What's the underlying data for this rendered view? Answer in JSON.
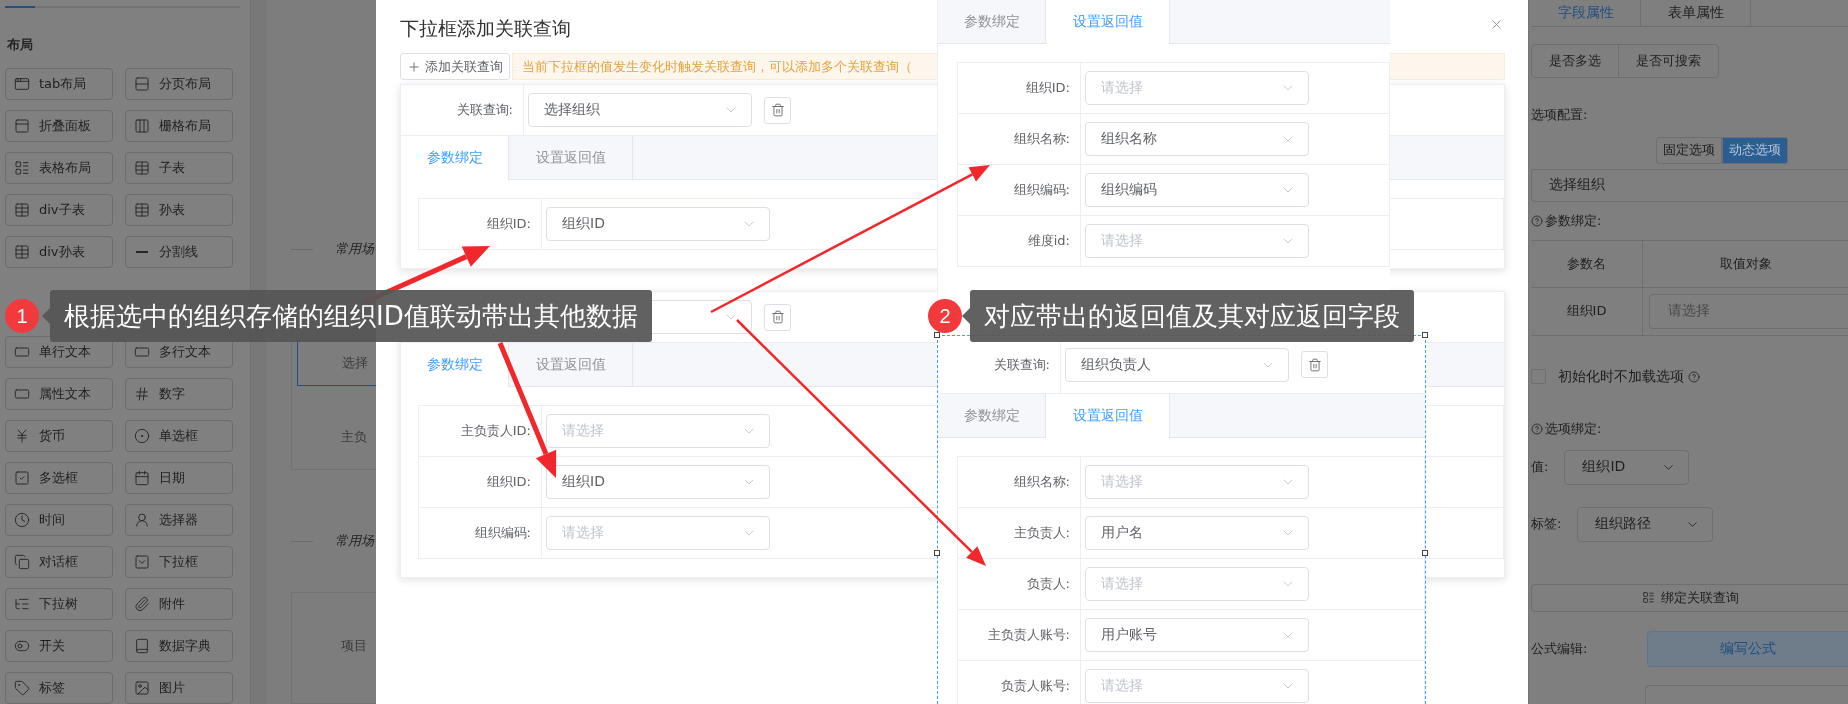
{
  "sidebar": {
    "sections": [
      {
        "title": "布局",
        "items": [
          {
            "label": "tab布局"
          },
          {
            "label": "分页布局"
          },
          {
            "label": "折叠面板"
          },
          {
            "label": "栅格布局"
          },
          {
            "label": "表格布局"
          },
          {
            "label": "子表"
          },
          {
            "label": "div子表"
          },
          {
            "label": "孙表"
          },
          {
            "label": "div孙表"
          },
          {
            "label": "分割线"
          }
        ]
      },
      {
        "items": [
          {
            "label": "单行文本"
          },
          {
            "label": "多行文本"
          },
          {
            "label": "属性文本"
          },
          {
            "label": "数字"
          },
          {
            "label": "货币"
          },
          {
            "label": "单选框"
          },
          {
            "label": "多选框"
          },
          {
            "label": "日期"
          },
          {
            "label": "时间"
          },
          {
            "label": "选择器"
          },
          {
            "label": "对话框"
          },
          {
            "label": "下拉框"
          },
          {
            "label": "下拉树"
          },
          {
            "label": "附件"
          },
          {
            "label": "开关"
          },
          {
            "label": "数据字典"
          },
          {
            "label": "标签"
          },
          {
            "label": "图片"
          }
        ]
      }
    ]
  },
  "canvas": {
    "headings": [
      "常用场",
      "常用场"
    ],
    "field_value": "选择",
    "texts": [
      "主负",
      "项目"
    ]
  },
  "dialog": {
    "title": "下拉框添加关联查询",
    "add_button": "添加关联查询",
    "notice": "当前下拉框的值发生变化时触发关联查询，可以添加多个关联查询（",
    "queries": [
      {
        "label": "关联查询:",
        "value": "选择组织",
        "tabs": [
          {
            "label": "参数绑定",
            "selected": true
          },
          {
            "label": "设置返回值",
            "selected": false
          }
        ],
        "fields": [
          {
            "label": "组织ID:",
            "value": "组织ID"
          }
        ]
      },
      {
        "tabs": [
          {
            "label": "参数绑定",
            "selected": true
          },
          {
            "label": "设置返回值",
            "selected": false
          }
        ],
        "fields": [
          {
            "label": "主负责人ID:",
            "placeholder": "请选择"
          },
          {
            "label": "组织ID:",
            "value": "组织ID"
          },
          {
            "label": "组织编码:",
            "placeholder": "请选择"
          }
        ]
      }
    ]
  },
  "overlays": [
    {
      "tabs": [
        {
          "label": "参数绑定",
          "selected": false
        },
        {
          "label": "设置返回值",
          "selected": true
        }
      ],
      "fields": [
        {
          "label": "组织ID:",
          "placeholder": "请选择"
        },
        {
          "label": "组织名称:",
          "value": "组织名称"
        },
        {
          "label": "组织编码:",
          "value": "组织编码"
        },
        {
          "label": "维度id:",
          "placeholder": "请选择"
        }
      ]
    },
    {
      "label": "关联查询:",
      "value": "组织负责人",
      "tabs": [
        {
          "label": "参数绑定",
          "selected": false
        },
        {
          "label": "设置返回值",
          "selected": true
        }
      ],
      "fields": [
        {
          "label": "组织名称:",
          "placeholder": "请选择"
        },
        {
          "label": "主负责人:",
          "value": "用户名"
        },
        {
          "label": "负责人:",
          "placeholder": "请选择"
        },
        {
          "label": "主负责人账号:",
          "value": "用户账号"
        },
        {
          "label": "负责人账号:",
          "placeholder": "请选择"
        }
      ]
    }
  ],
  "callouts": [
    {
      "number": "1",
      "text": "根据选中的组织存储的组织ID值联动带出其他数据"
    },
    {
      "number": "2",
      "text": "对应带出的返回值及其对应返回字段"
    }
  ],
  "right_panel": {
    "tabs": [
      {
        "label": "字段属性",
        "selected": true
      },
      {
        "label": "表单属性",
        "selected": false
      }
    ],
    "toggles": [
      "是否多选",
      "是否可搜索"
    ],
    "options_label": "选项配置:",
    "option_modes": [
      {
        "label": "固定选项",
        "selected": false
      },
      {
        "label": "动态选项",
        "selected": true
      }
    ],
    "source_value": "选择组织",
    "param_label": "参数绑定:",
    "param_table": {
      "columns": [
        "参数名",
        "取值对象"
      ],
      "rows": [
        {
          "name": "组织ID",
          "placeholder": "请选择"
        }
      ]
    },
    "no_preload": {
      "label": "初始化时不加载选项",
      "checked": false
    },
    "binding_label": "选项绑定:",
    "value_field": {
      "label": "值:",
      "value": "组织ID"
    },
    "label_field": {
      "label": "标签:",
      "value": "组织路径"
    },
    "bind_button": "绑定关联查询",
    "formula_label": "公式编辑:",
    "formula_button": "编写公式"
  }
}
